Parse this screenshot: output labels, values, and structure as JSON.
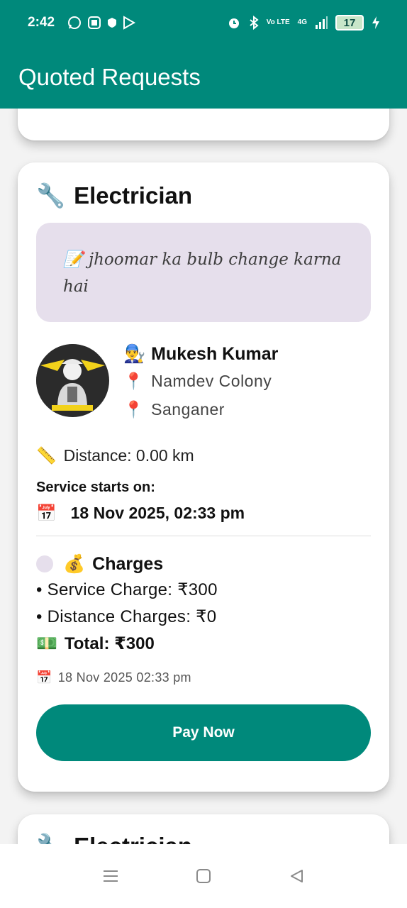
{
  "status_bar": {
    "time": "2:42",
    "volte": "Vo LTE",
    "network": "4G",
    "battery": "17"
  },
  "app_bar": {
    "title": "Quoted Requests"
  },
  "requests": [
    {
      "service": "Electrician",
      "service_icon": "wrench-icon",
      "description": "jhoomar ka bulb change karna hai",
      "provider": {
        "name": "Mukesh Kumar",
        "locations": [
          "Namdev Colony",
          "Sanganer"
        ]
      },
      "distance": "Distance: 0.00 km",
      "starts_label": "Service starts on:",
      "starts_date": "18 Nov 2025, 02:33 pm",
      "charges_title": "Charges",
      "service_charge": "• Service Charge: ₹300",
      "distance_charge": "• Distance Charges: ₹0",
      "total": "Total: ₹300",
      "created": "18 Nov 2025 02:33 pm",
      "pay_label": "Pay Now"
    },
    {
      "service": "Electrician",
      "service_icon": "wrench-icon"
    }
  ],
  "colors": {
    "primary": "#00897b",
    "description_bg": "#e6dfec"
  }
}
